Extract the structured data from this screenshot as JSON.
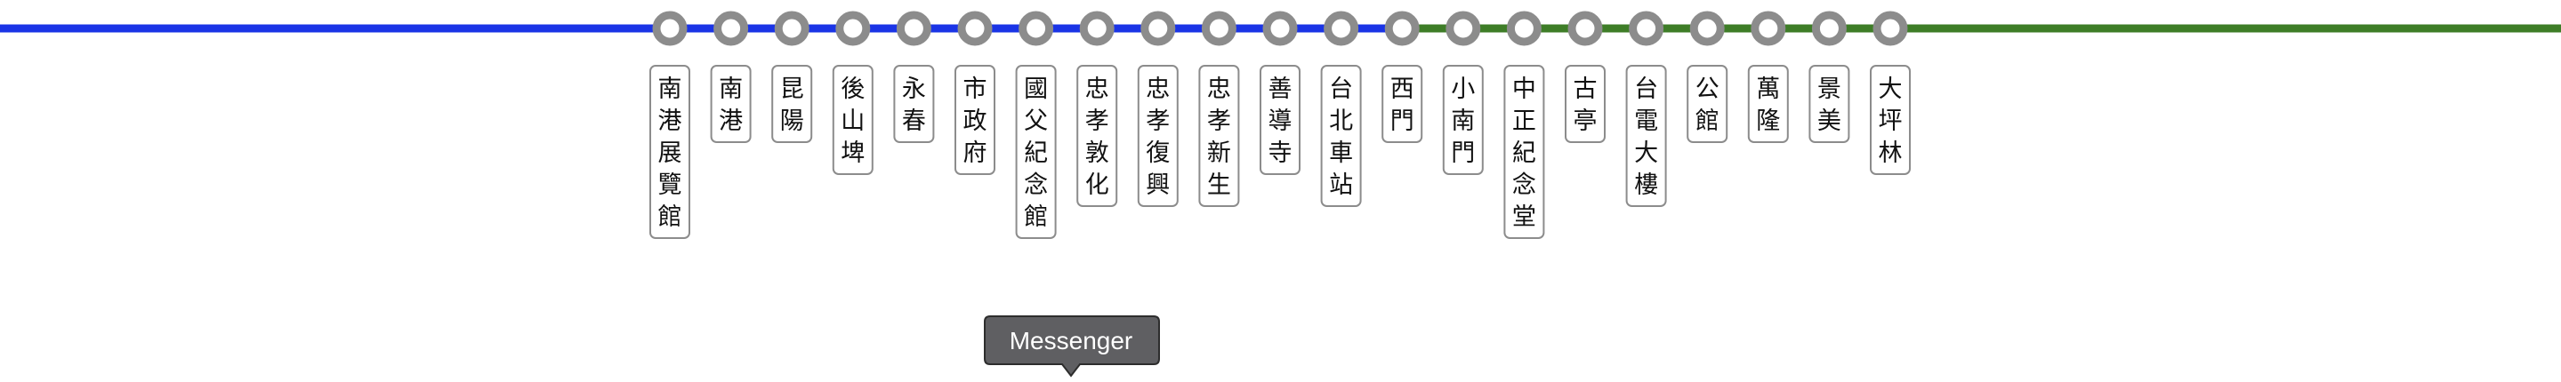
{
  "colors": {
    "line_west": "#1a34e6",
    "line_east": "#3e7d27",
    "station_ring": "#8c8c8c",
    "label_border": "#8c8c8c",
    "tooltip_bg": "#5f5f62",
    "tooltip_border": "#2d2d2d"
  },
  "icons": {
    "station_marker": "ring-circle-icon"
  },
  "stations": [
    {
      "name": "南港展覽館",
      "segment": "west"
    },
    {
      "name": "南港",
      "segment": "west"
    },
    {
      "name": "昆陽",
      "segment": "west"
    },
    {
      "name": "後山埤",
      "segment": "west"
    },
    {
      "name": "永春",
      "segment": "west"
    },
    {
      "name": "市政府",
      "segment": "west"
    },
    {
      "name": "國父紀念館",
      "segment": "west"
    },
    {
      "name": "忠孝敦化",
      "segment": "west"
    },
    {
      "name": "忠孝復興",
      "segment": "west"
    },
    {
      "name": "忠孝新生",
      "segment": "west"
    },
    {
      "name": "善導寺",
      "segment": "west"
    },
    {
      "name": "台北車站",
      "segment": "west"
    },
    {
      "name": "西門",
      "segment": "west"
    },
    {
      "name": "小南門",
      "segment": "east"
    },
    {
      "name": "中正紀念堂",
      "segment": "east"
    },
    {
      "name": "古亭",
      "segment": "east"
    },
    {
      "name": "台電大樓",
      "segment": "east"
    },
    {
      "name": "公館",
      "segment": "east"
    },
    {
      "name": "萬隆",
      "segment": "east"
    },
    {
      "name": "景美",
      "segment": "east"
    },
    {
      "name": "大坪林",
      "segment": "east"
    }
  ],
  "tooltip": {
    "label": "Messenger"
  }
}
